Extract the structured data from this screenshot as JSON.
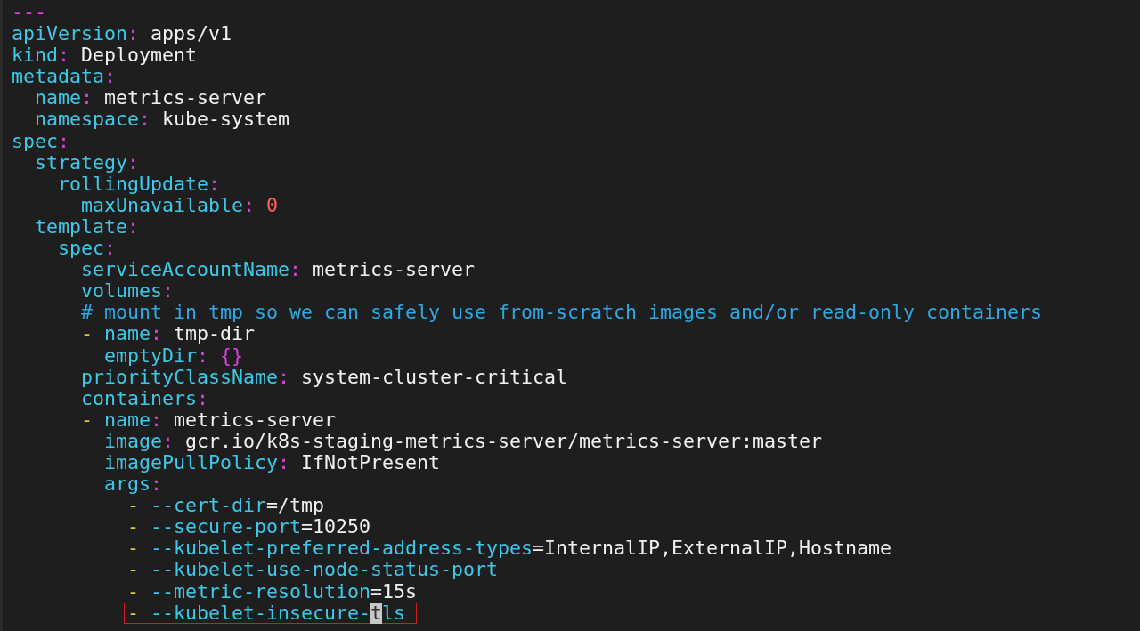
{
  "editor": {
    "lines": [
      {
        "tokens": [
          {
            "kind": "separator",
            "text": "---"
          }
        ]
      },
      {
        "tokens": [
          {
            "kind": "key",
            "text": "apiVersion"
          },
          {
            "kind": "colon",
            "text": ":"
          },
          {
            "kind": "value",
            "text": "apps/v1"
          }
        ]
      },
      {
        "tokens": [
          {
            "kind": "key",
            "text": "kind"
          },
          {
            "kind": "colon",
            "text": ":"
          },
          {
            "kind": "value",
            "text": "Deployment"
          }
        ]
      },
      {
        "tokens": [
          {
            "kind": "key",
            "text": "metadata"
          },
          {
            "kind": "colon",
            "text": ":"
          }
        ],
        "children": [
          {
            "tokens": [
              {
                "kind": "key",
                "text": "name"
              },
              {
                "kind": "colon",
                "text": ":"
              },
              {
                "kind": "value",
                "text": "metrics-server"
              }
            ]
          },
          {
            "tokens": [
              {
                "kind": "key",
                "text": "namespace"
              },
              {
                "kind": "colon",
                "text": ":"
              },
              {
                "kind": "value",
                "text": "kube-system"
              }
            ]
          }
        ]
      },
      {
        "tokens": [
          {
            "kind": "key",
            "text": "spec"
          },
          {
            "kind": "colon",
            "text": ":"
          }
        ],
        "children": [
          {
            "tokens": [
              {
                "kind": "key",
                "text": "strategy"
              },
              {
                "kind": "colon",
                "text": ":"
              }
            ],
            "children": [
              {
                "tokens": [
                  {
                    "kind": "key",
                    "text": "rollingUpdate"
                  },
                  {
                    "kind": "colon",
                    "text": ":"
                  }
                ],
                "children": [
                  {
                    "tokens": [
                      {
                        "kind": "key",
                        "text": "maxUnavailable"
                      },
                      {
                        "kind": "colon",
                        "text": ":"
                      },
                      {
                        "kind": "number",
                        "text": "0"
                      }
                    ]
                  }
                ]
              }
            ]
          },
          {
            "tokens": [
              {
                "kind": "key",
                "text": "template"
              },
              {
                "kind": "colon",
                "text": ":"
              }
            ],
            "children": [
              {
                "tokens": [
                  {
                    "kind": "key",
                    "text": "spec"
                  },
                  {
                    "kind": "colon",
                    "text": ":"
                  }
                ],
                "children": [
                  {
                    "tokens": [
                      {
                        "kind": "key",
                        "text": "serviceAccountName"
                      },
                      {
                        "kind": "colon",
                        "text": ":"
                      },
                      {
                        "kind": "value",
                        "text": "metrics-server"
                      }
                    ]
                  },
                  {
                    "tokens": [
                      {
                        "kind": "key",
                        "text": "volumes"
                      },
                      {
                        "kind": "colon",
                        "text": ":"
                      }
                    ]
                  },
                  {
                    "tokens": [
                      {
                        "kind": "comment",
                        "text": "# mount in tmp so we can safely use from-scratch images and/or read-only containers"
                      }
                    ]
                  },
                  {
                    "tokens": [
                      {
                        "kind": "dash",
                        "text": "-"
                      },
                      {
                        "kind": "key",
                        "text": "name"
                      },
                      {
                        "kind": "colon",
                        "text": ":"
                      },
                      {
                        "kind": "value",
                        "text": "tmp-dir"
                      }
                    ],
                    "children": [
                      {
                        "tokens": [
                          {
                            "kind": "key",
                            "text": "emptyDir"
                          },
                          {
                            "kind": "colon",
                            "text": ":"
                          },
                          {
                            "kind": "brace",
                            "text": "{}"
                          }
                        ]
                      }
                    ]
                  },
                  {
                    "tokens": [
                      {
                        "kind": "key",
                        "text": "priorityClassName"
                      },
                      {
                        "kind": "colon",
                        "text": ":"
                      },
                      {
                        "kind": "value",
                        "text": "system-cluster-critical"
                      }
                    ]
                  },
                  {
                    "tokens": [
                      {
                        "kind": "key",
                        "text": "containers"
                      },
                      {
                        "kind": "colon",
                        "text": ":"
                      }
                    ]
                  },
                  {
                    "tokens": [
                      {
                        "kind": "dash",
                        "text": "-"
                      },
                      {
                        "kind": "key",
                        "text": "name"
                      },
                      {
                        "kind": "colon",
                        "text": ":"
                      },
                      {
                        "kind": "value",
                        "text": "metrics-server"
                      }
                    ],
                    "children": [
                      {
                        "tokens": [
                          {
                            "kind": "key",
                            "text": "image"
                          },
                          {
                            "kind": "colon",
                            "text": ":"
                          },
                          {
                            "kind": "value",
                            "text": "gcr.io/k8s-staging-metrics-server/metrics-server:master"
                          }
                        ]
                      },
                      {
                        "tokens": [
                          {
                            "kind": "key",
                            "text": "imagePullPolicy"
                          },
                          {
                            "kind": "colon",
                            "text": ":"
                          },
                          {
                            "kind": "value",
                            "text": "IfNotPresent"
                          }
                        ]
                      },
                      {
                        "tokens": [
                          {
                            "kind": "key",
                            "text": "args"
                          },
                          {
                            "kind": "colon",
                            "text": ":"
                          }
                        ],
                        "children": [
                          {
                            "tokens": [
                              {
                                "kind": "dash",
                                "text": "-"
                              },
                              {
                                "kind": "flag",
                                "text": "--cert-dir"
                              },
                              {
                                "kind": "argvalue",
                                "text": "=/tmp"
                              }
                            ]
                          },
                          {
                            "tokens": [
                              {
                                "kind": "dash",
                                "text": "-"
                              },
                              {
                                "kind": "flag",
                                "text": "--secure-port"
                              },
                              {
                                "kind": "argvalue",
                                "text": "=10250"
                              }
                            ]
                          },
                          {
                            "tokens": [
                              {
                                "kind": "dash",
                                "text": "-"
                              },
                              {
                                "kind": "flag",
                                "text": "--kubelet-preferred-address-types"
                              },
                              {
                                "kind": "argvalue",
                                "text": "=InternalIP,ExternalIP,Hostname"
                              }
                            ]
                          },
                          {
                            "tokens": [
                              {
                                "kind": "dash",
                                "text": "-"
                              },
                              {
                                "kind": "flag",
                                "text": "--kubelet-use-node-status-port"
                              }
                            ]
                          },
                          {
                            "tokens": [
                              {
                                "kind": "dash",
                                "text": "-"
                              },
                              {
                                "kind": "flag",
                                "text": "--metric-resolution"
                              },
                              {
                                "kind": "argvalue",
                                "text": "=15s"
                              }
                            ]
                          },
                          {
                            "boxed": true,
                            "tokens": [
                              {
                                "kind": "dash",
                                "text": "-"
                              },
                              {
                                "kind": "flag",
                                "text": "--kubelet-insecure-"
                              },
                              {
                                "kind": "cursor",
                                "text": "t"
                              },
                              {
                                "kind": "flag",
                                "text": "ls"
                              }
                            ]
                          }
                        ]
                      }
                    ]
                  }
                ]
              }
            ]
          }
        ]
      }
    ]
  }
}
